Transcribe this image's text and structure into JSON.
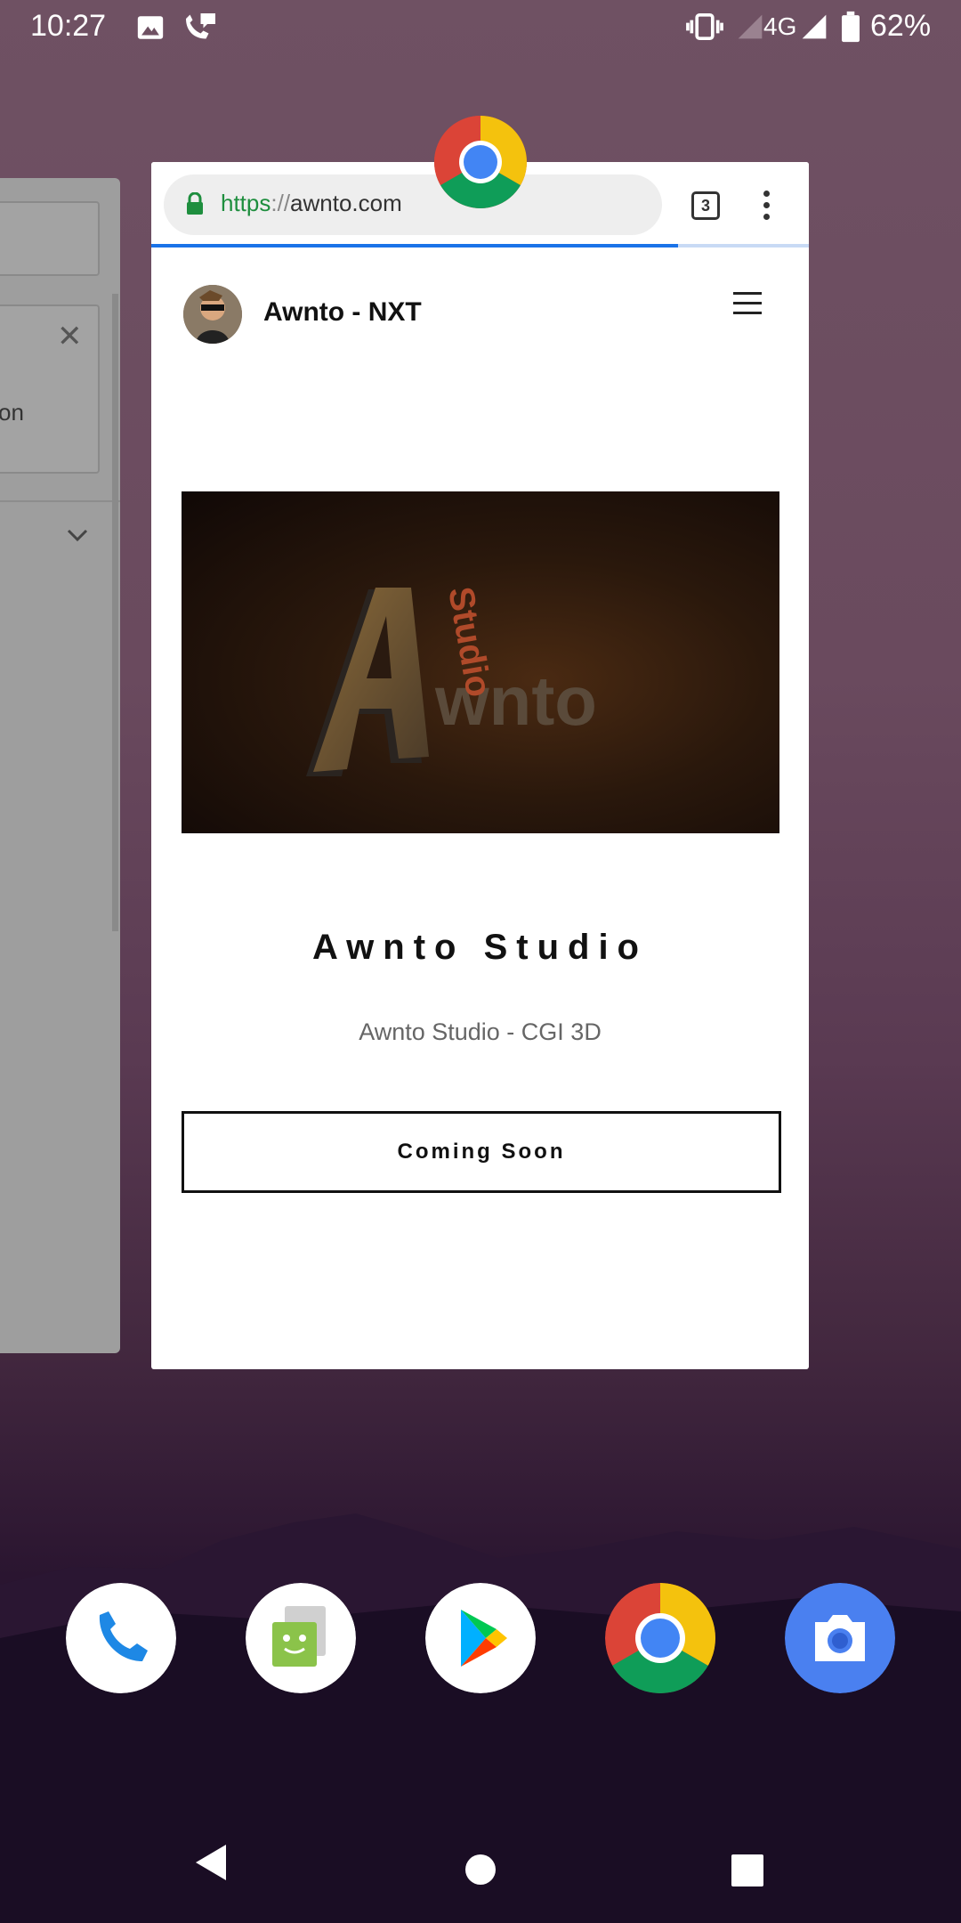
{
  "status_bar": {
    "time": "10:27",
    "network": "4G",
    "battery": "62%"
  },
  "background_card": {
    "partial_text": "on"
  },
  "browser": {
    "url_scheme": "https",
    "url_sep": "://",
    "url_host": "awnto.com",
    "tab_count": "3",
    "accent_color": "#1a73e8",
    "lock_color": "#1e8e3e"
  },
  "site": {
    "name": "Awnto - NXT",
    "hero_logo": {
      "letter": "A",
      "word": "wnto",
      "studio": "Studio"
    },
    "title": "Awnto Studio",
    "subtitle": "Awnto Studio - CGI 3D",
    "button_label": "Coming Soon"
  },
  "dock": {
    "apps": [
      "phone-icon",
      "messages-icon",
      "play-store-icon",
      "chrome-icon",
      "camera-icon"
    ]
  }
}
